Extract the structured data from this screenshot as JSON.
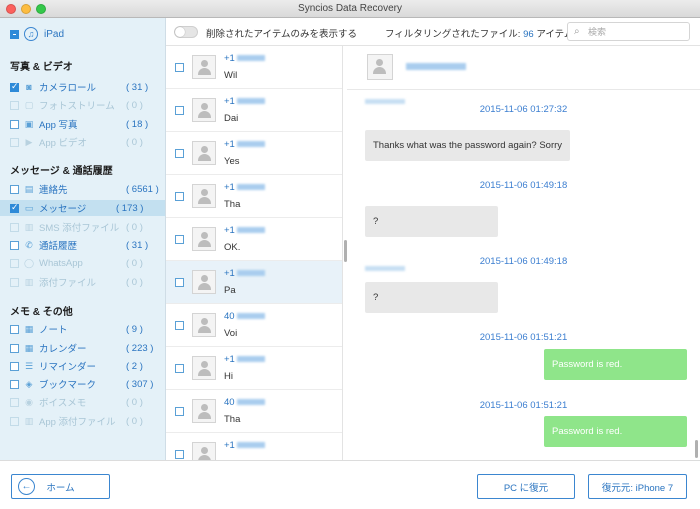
{
  "window": {
    "title": "Syncios Data Recovery"
  },
  "sidebar": {
    "device": "iPad",
    "sections": [
      {
        "title": "写真 & ビデオ",
        "items": [
          {
            "label": "カメラロール",
            "count": "( 31 )",
            "state": "checked",
            "icon": "camera-icon"
          },
          {
            "label": "フォトストリーム",
            "count": "( 0 )",
            "state": "disabled",
            "icon": "photostream-icon"
          },
          {
            "label": "App 写真",
            "count": "( 18 )",
            "state": "unchecked",
            "icon": "photo-icon"
          },
          {
            "label": "App ビデオ",
            "count": "( 0 )",
            "state": "disabled",
            "icon": "video-icon"
          }
        ]
      },
      {
        "title": "メッセージ & 通話履歴",
        "items": [
          {
            "label": "連絡先",
            "count": "( 6561 )",
            "state": "unchecked",
            "icon": "contacts-icon"
          },
          {
            "label": "メッセージ",
            "count": "( 173 )",
            "state": "checked",
            "icon": "message-icon"
          },
          {
            "label": "SMS 添付ファイル",
            "count": "( 0 )",
            "state": "disabled",
            "icon": "attachment-icon"
          },
          {
            "label": "通話履歴",
            "count": "( 31 )",
            "state": "unchecked",
            "icon": "call-history-icon"
          },
          {
            "label": "WhatsApp",
            "count": "( 0 )",
            "state": "disabled",
            "icon": "whatsapp-icon"
          },
          {
            "label": "添付ファイル",
            "count": "( 0 )",
            "state": "disabled",
            "icon": "attachment-icon"
          }
        ]
      },
      {
        "title": "メモ & その他",
        "items": [
          {
            "label": "ノート",
            "count": "( 9 )",
            "state": "unchecked",
            "icon": "note-icon"
          },
          {
            "label": "カレンダー",
            "count": "( 223 )",
            "state": "unchecked",
            "icon": "calendar-icon"
          },
          {
            "label": "リマインダー",
            "count": "( 2 )",
            "state": "unchecked",
            "icon": "reminder-icon"
          },
          {
            "label": "ブックマーク",
            "count": "( 307 )",
            "state": "unchecked",
            "icon": "bookmark-icon"
          },
          {
            "label": "ボイスメモ",
            "count": "( 0 )",
            "state": "disabled",
            "icon": "voice-memo-icon"
          },
          {
            "label": "App 添付ファイル",
            "count": "( 0 )",
            "state": "disabled",
            "icon": "attachment-icon"
          }
        ]
      }
    ]
  },
  "toolbar": {
    "toggle_label": "削除されたアイテムのみを表示する",
    "filter_prefix": "フィルタリングされたファイル:",
    "filter_count": "96",
    "filter_suffix": "アイテム",
    "search_placeholder": "検索"
  },
  "messages_list": [
    {
      "number": "+1",
      "preview": "Wil"
    },
    {
      "number": "+1",
      "preview": "Dai"
    },
    {
      "number": "+1",
      "preview": "Yes"
    },
    {
      "number": "+1",
      "preview": "Tha"
    },
    {
      "number": "+1",
      "preview": "OK."
    },
    {
      "number": "+1",
      "preview": "Pa"
    },
    {
      "number": "40",
      "preview": "Voi"
    },
    {
      "number": "+1",
      "preview": "Hi"
    },
    {
      "number": "40",
      "preview": "Tha"
    },
    {
      "number": "+1",
      "preview": ""
    }
  ],
  "conversation": {
    "messages": [
      {
        "timestamp": "2015-11-06 01:27:32",
        "direction": "in",
        "text": "Thanks what was the password again? Sorry"
      },
      {
        "timestamp": "2015-11-06 01:49:18",
        "direction": "in",
        "text": "?"
      },
      {
        "timestamp": "2015-11-06 01:49:18",
        "direction": "in",
        "text": "?"
      },
      {
        "timestamp": "2015-11-06 01:51:21",
        "direction": "out",
        "text": "Password is red."
      },
      {
        "timestamp": "2015-11-06 01:51:21",
        "direction": "out",
        "text": "Password is red."
      }
    ]
  },
  "footer": {
    "home_label": "ホーム",
    "recover_pc_label": "PC に復元",
    "recover_device_label": "復元元: iPhone 7"
  }
}
